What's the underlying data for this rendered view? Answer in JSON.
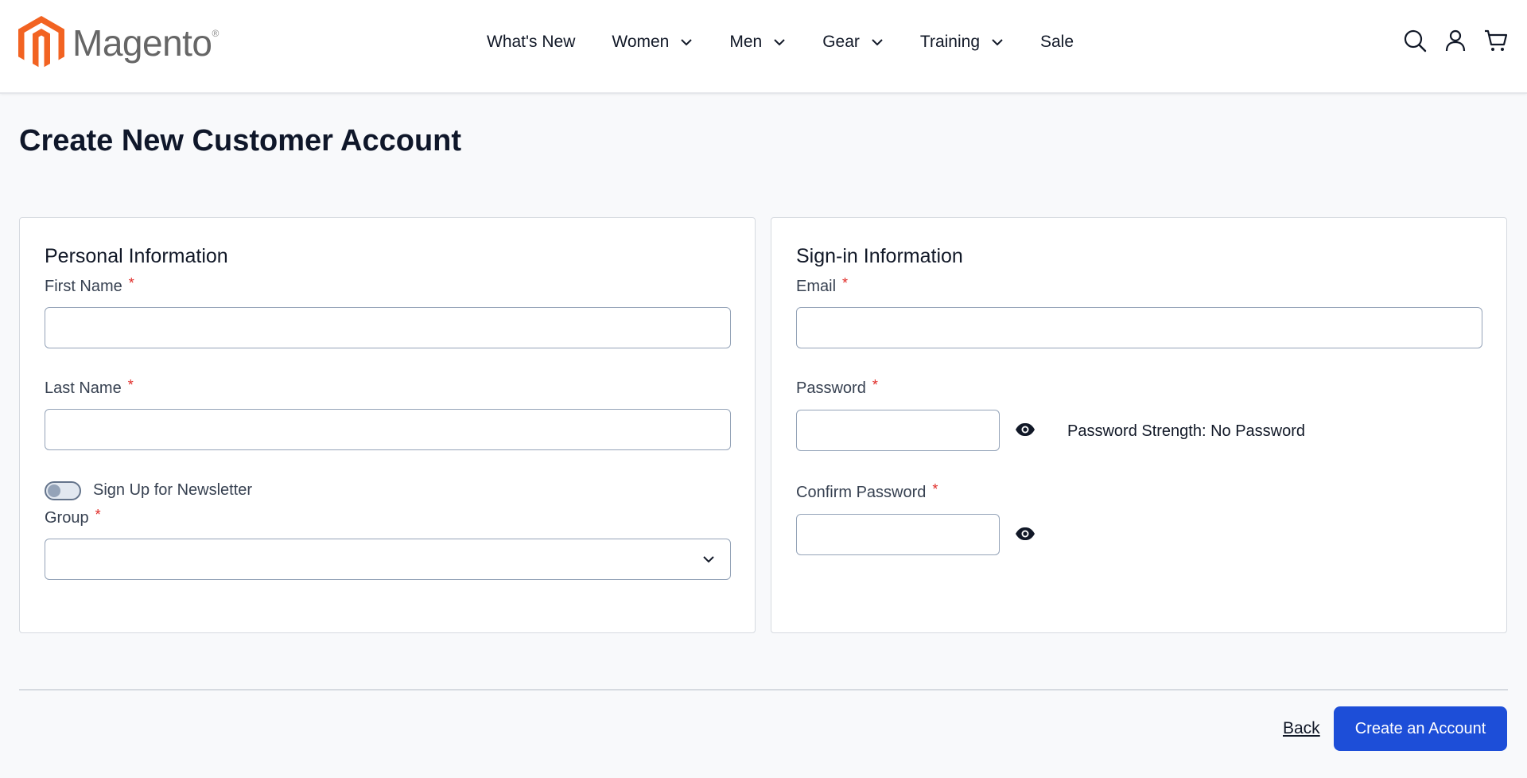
{
  "brand": {
    "name": "Magento",
    "trademark": "®",
    "accent_color": "#f26322"
  },
  "nav": {
    "items": [
      {
        "label": "What's New",
        "has_dropdown": false
      },
      {
        "label": "Women",
        "has_dropdown": true
      },
      {
        "label": "Men",
        "has_dropdown": true
      },
      {
        "label": "Gear",
        "has_dropdown": true
      },
      {
        "label": "Training",
        "has_dropdown": true
      },
      {
        "label": "Sale",
        "has_dropdown": false
      }
    ]
  },
  "header_icons": [
    "search-icon",
    "account-icon",
    "cart-icon"
  ],
  "page": {
    "title": "Create New Customer Account"
  },
  "personal": {
    "title": "Personal Information",
    "first_name_label": "First Name",
    "first_name_value": "",
    "last_name_label": "Last Name",
    "last_name_value": "",
    "newsletter_label": "Sign Up for Newsletter",
    "newsletter_checked": false,
    "group_label": "Group",
    "group_value": ""
  },
  "signin": {
    "title": "Sign-in Information",
    "email_label": "Email",
    "email_value": "",
    "password_label": "Password",
    "password_strength": "Password Strength: No Password",
    "confirm_password_label": "Confirm Password"
  },
  "required_marker": "*",
  "actions": {
    "back_label": "Back",
    "submit_label": "Create an Account",
    "submit_color": "#1d4ed8"
  }
}
